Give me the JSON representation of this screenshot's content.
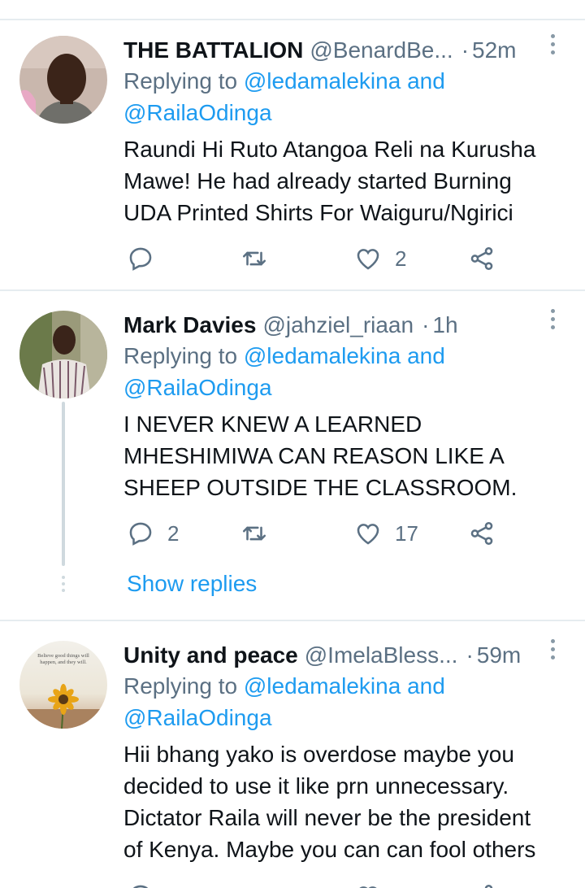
{
  "tweets": [
    {
      "name": "THE BATTALION",
      "handle": "@BenardBe...",
      "sep": "·",
      "time": "52m",
      "replying_prefix": "Replying to",
      "replying_mention1": "@ledamalekina and",
      "replying_mention2": "@RailaOdinga",
      "lines": [
        "Raundi Hi Ruto Atangoa Reli na Kurusha",
        "Mawe! He had already started Burning",
        "UDA Printed Shirts For Waiguru/Ngirici"
      ],
      "reply_count": "",
      "retweet_count": "",
      "like_count": "2"
    },
    {
      "name": "Mark Davies",
      "handle": "@jahziel_riaan",
      "sep": "·",
      "time": "1h",
      "replying_prefix": "Replying to",
      "replying_mention1": "@ledamalekina and",
      "replying_mention2": "@RailaOdinga",
      "lines": [
        "I NEVER KNEW A LEARNED",
        "MHESHIMIWA CAN REASON LIKE A",
        "SHEEP OUTSIDE THE CLASSROOM."
      ],
      "reply_count": "2",
      "retweet_count": "",
      "like_count": "17",
      "show_replies": "Show replies"
    },
    {
      "name": "Unity and peace",
      "handle": "@ImelaBless...",
      "sep": "·",
      "time": "59m",
      "replying_prefix": "Replying to",
      "replying_mention1": "@ledamalekina and",
      "replying_mention2": "@RailaOdinga",
      "lines": [
        "Hii bhang yako is overdose maybe you",
        "decided to use it like prn unnecessary.",
        "Dictator Raila will never be the president",
        "of Kenya. Maybe you can can fool others"
      ],
      "avatar_text_line1": "Believe good things will",
      "avatar_text_line2": "happen, and they will."
    }
  ],
  "colors": {
    "accent": "#1d9bf0",
    "secondary_text": "#5b7083",
    "divider": "#e6ecf0"
  },
  "icons": [
    "reply-icon",
    "retweet-icon",
    "like-icon",
    "share-icon",
    "more-icon"
  ]
}
